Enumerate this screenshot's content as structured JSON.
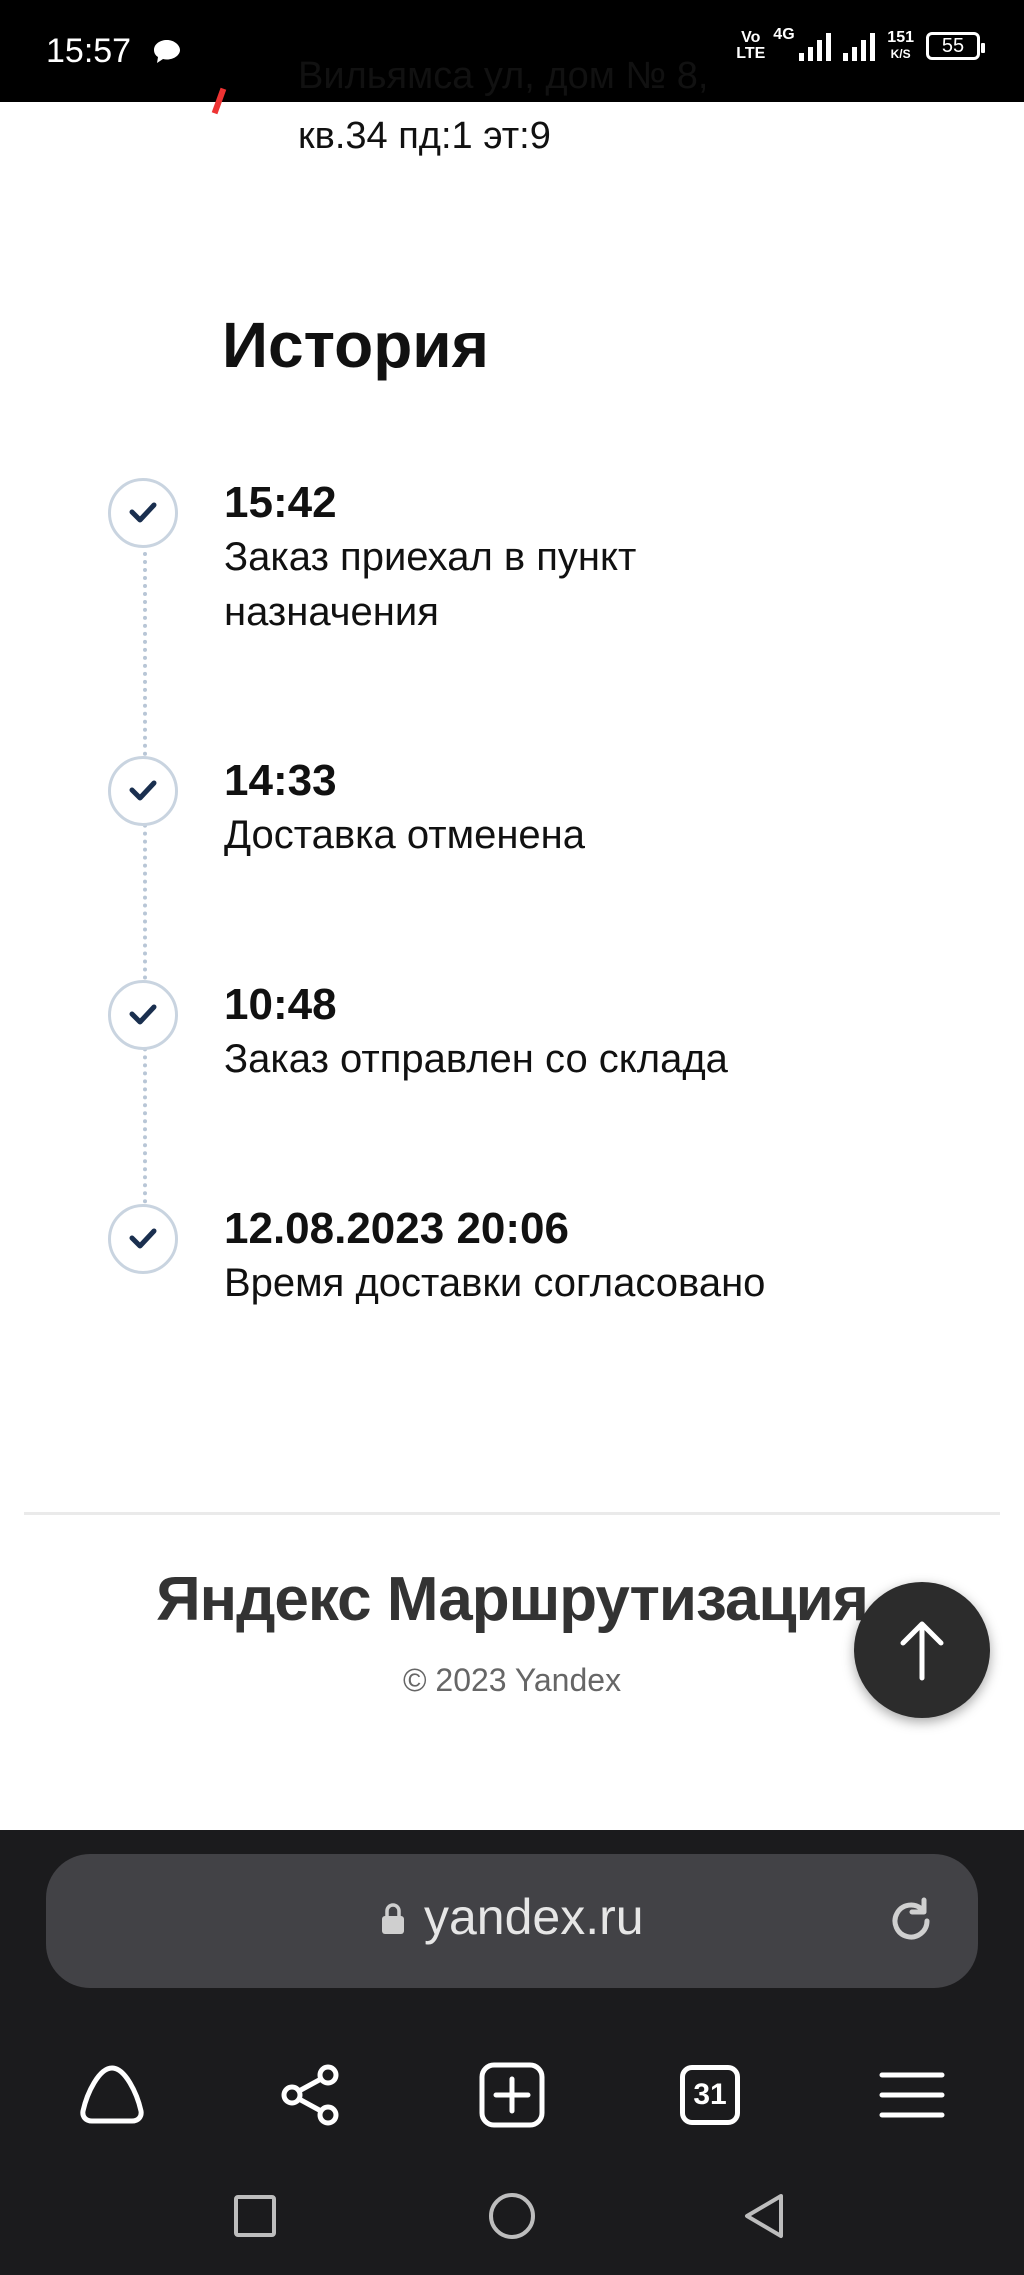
{
  "status_bar": {
    "time": "15:57",
    "volte_top": "Vo",
    "volte_bottom": "LTE",
    "network": "4G",
    "speed_value": "151",
    "speed_unit": "K/S",
    "battery": "55"
  },
  "address": {
    "line1": "Вильямса ул, дом № 8,",
    "line2": "кв.34 пд:1 эт:9"
  },
  "history": {
    "title": "История",
    "events": [
      {
        "time": "15:42",
        "description": "Заказ приехал в пункт назначения"
      },
      {
        "time": "14:33",
        "description": "Доставка отменена"
      },
      {
        "time": "10:48",
        "description": "Заказ отправлен со склада"
      },
      {
        "time": "12.08.2023 20:06",
        "description": "Время доставки согласовано"
      }
    ]
  },
  "footer": {
    "brand": "Яндекс Маршрутизация",
    "copyright": "© 2023 Yandex"
  },
  "browser": {
    "url": "yandex.ru",
    "tabs_count": "31"
  },
  "icons": {
    "check": "check-icon",
    "scroll_top": "arrow-up-icon",
    "lock": "lock-icon",
    "reload": "reload-icon",
    "alice": "alice-icon",
    "share": "share-icon",
    "new_tab": "plus-square-icon",
    "tabs": "tabs-count-icon",
    "menu": "hamburger-menu-icon"
  },
  "colors": {
    "check_mark": "#1a2f4f",
    "timeline": "#b8c6d6",
    "browser_bg": "#1b1b1d",
    "url_bar": "#424246"
  }
}
